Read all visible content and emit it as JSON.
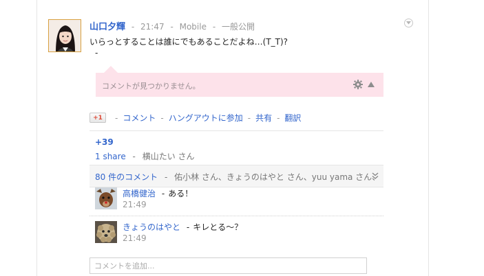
{
  "post": {
    "author": "山口夕輝",
    "time": "21:47",
    "client": "Mobile",
    "visibility": "一般公開",
    "text": "いらっとすることは誰にでもあることだよね…(T_T)?",
    "text_dash": "-"
  },
  "notice": {
    "text": "コメントが見つかりません。"
  },
  "actions": {
    "plusone": "+1",
    "comment": "コメント",
    "hangout": "ハングアウトに参加",
    "share": "共有",
    "translate": "翻訳",
    "separator": "-"
  },
  "stats": {
    "plus_count": "+39",
    "shares": "1 share",
    "sharer": "横山たい さん",
    "separator": "-"
  },
  "comments_summary": {
    "count": "80",
    "label": " 件のコメント",
    "commenters": "佑小林 さん、きょうのはやと さん、yuu yama さん、",
    "separator": "-"
  },
  "comments": [
    {
      "author": "高橋健治",
      "text": "ある！",
      "time": "21:49",
      "separator": "-"
    },
    {
      "author": "きょうのはやと",
      "text": "キレとる〜？",
      "time": "21:49",
      "separator": "-"
    }
  ],
  "add_comment": {
    "placeholder": "コメントを追加..."
  },
  "colors": {
    "link": "#3366cc",
    "notice_bg": "#fde2ea",
    "muted": "#999999"
  }
}
